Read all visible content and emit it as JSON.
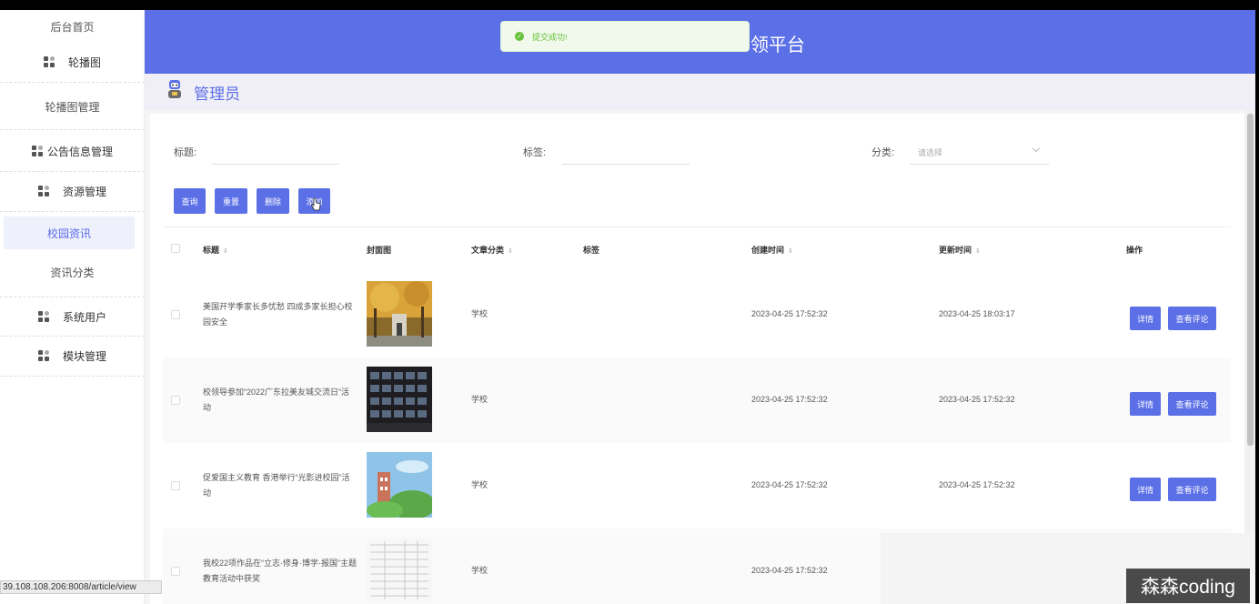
{
  "toast": {
    "message": "提交成功!"
  },
  "header": {
    "title": "领平台"
  },
  "role": {
    "label": "管理员"
  },
  "sidebar": {
    "items": [
      {
        "label": "后台首页"
      },
      {
        "label": "轮播图"
      },
      {
        "label": "轮播图管理"
      },
      {
        "label": "公告信息管理"
      },
      {
        "label": "资源管理"
      },
      {
        "label": "校园资讯"
      },
      {
        "label": "资讯分类"
      },
      {
        "label": "系统用户"
      },
      {
        "label": "模块管理"
      }
    ]
  },
  "filters": {
    "title_label": "标题:",
    "tag_label": "标签:",
    "category_label": "分类:",
    "category_placeholder": "请选择"
  },
  "toolbar": {
    "query": "查询",
    "reset": "重置",
    "delete": "删除",
    "add": "添加"
  },
  "table": {
    "columns": [
      "标题",
      "封面图",
      "文章分类",
      "标签",
      "创建时间",
      "更新时间",
      "操作"
    ],
    "rows": [
      {
        "title": "美国开学季家长多忧愁 四成多家长担心校园安全",
        "category": "学校",
        "tag": "",
        "created": "2023-04-25 17:52:32",
        "updated": "2023-04-25 18:03:17"
      },
      {
        "title": "校领导参加“2022广东拉美友城交流日”活动",
        "category": "学校",
        "tag": "",
        "created": "2023-04-25 17:52:32",
        "updated": "2023-04-25 17:52:32"
      },
      {
        "title": "促爱国主义教育 香港举行“光影进校园”活动",
        "category": "学校",
        "tag": "",
        "created": "2023-04-25 17:52:32",
        "updated": "2023-04-25 17:52:32"
      },
      {
        "title": "我校22项作品在“立志·修身·博学·报国”主题教育活动中获奖",
        "category": "学校",
        "tag": "",
        "created": "2023-04-25 17:52:32",
        "updated": ""
      }
    ],
    "detail_label": "详情",
    "comments_label": "查看评论"
  },
  "status_bar": {
    "url": "39.108.108.206:8008/article/view"
  },
  "watermark": {
    "text": "森森coding"
  }
}
